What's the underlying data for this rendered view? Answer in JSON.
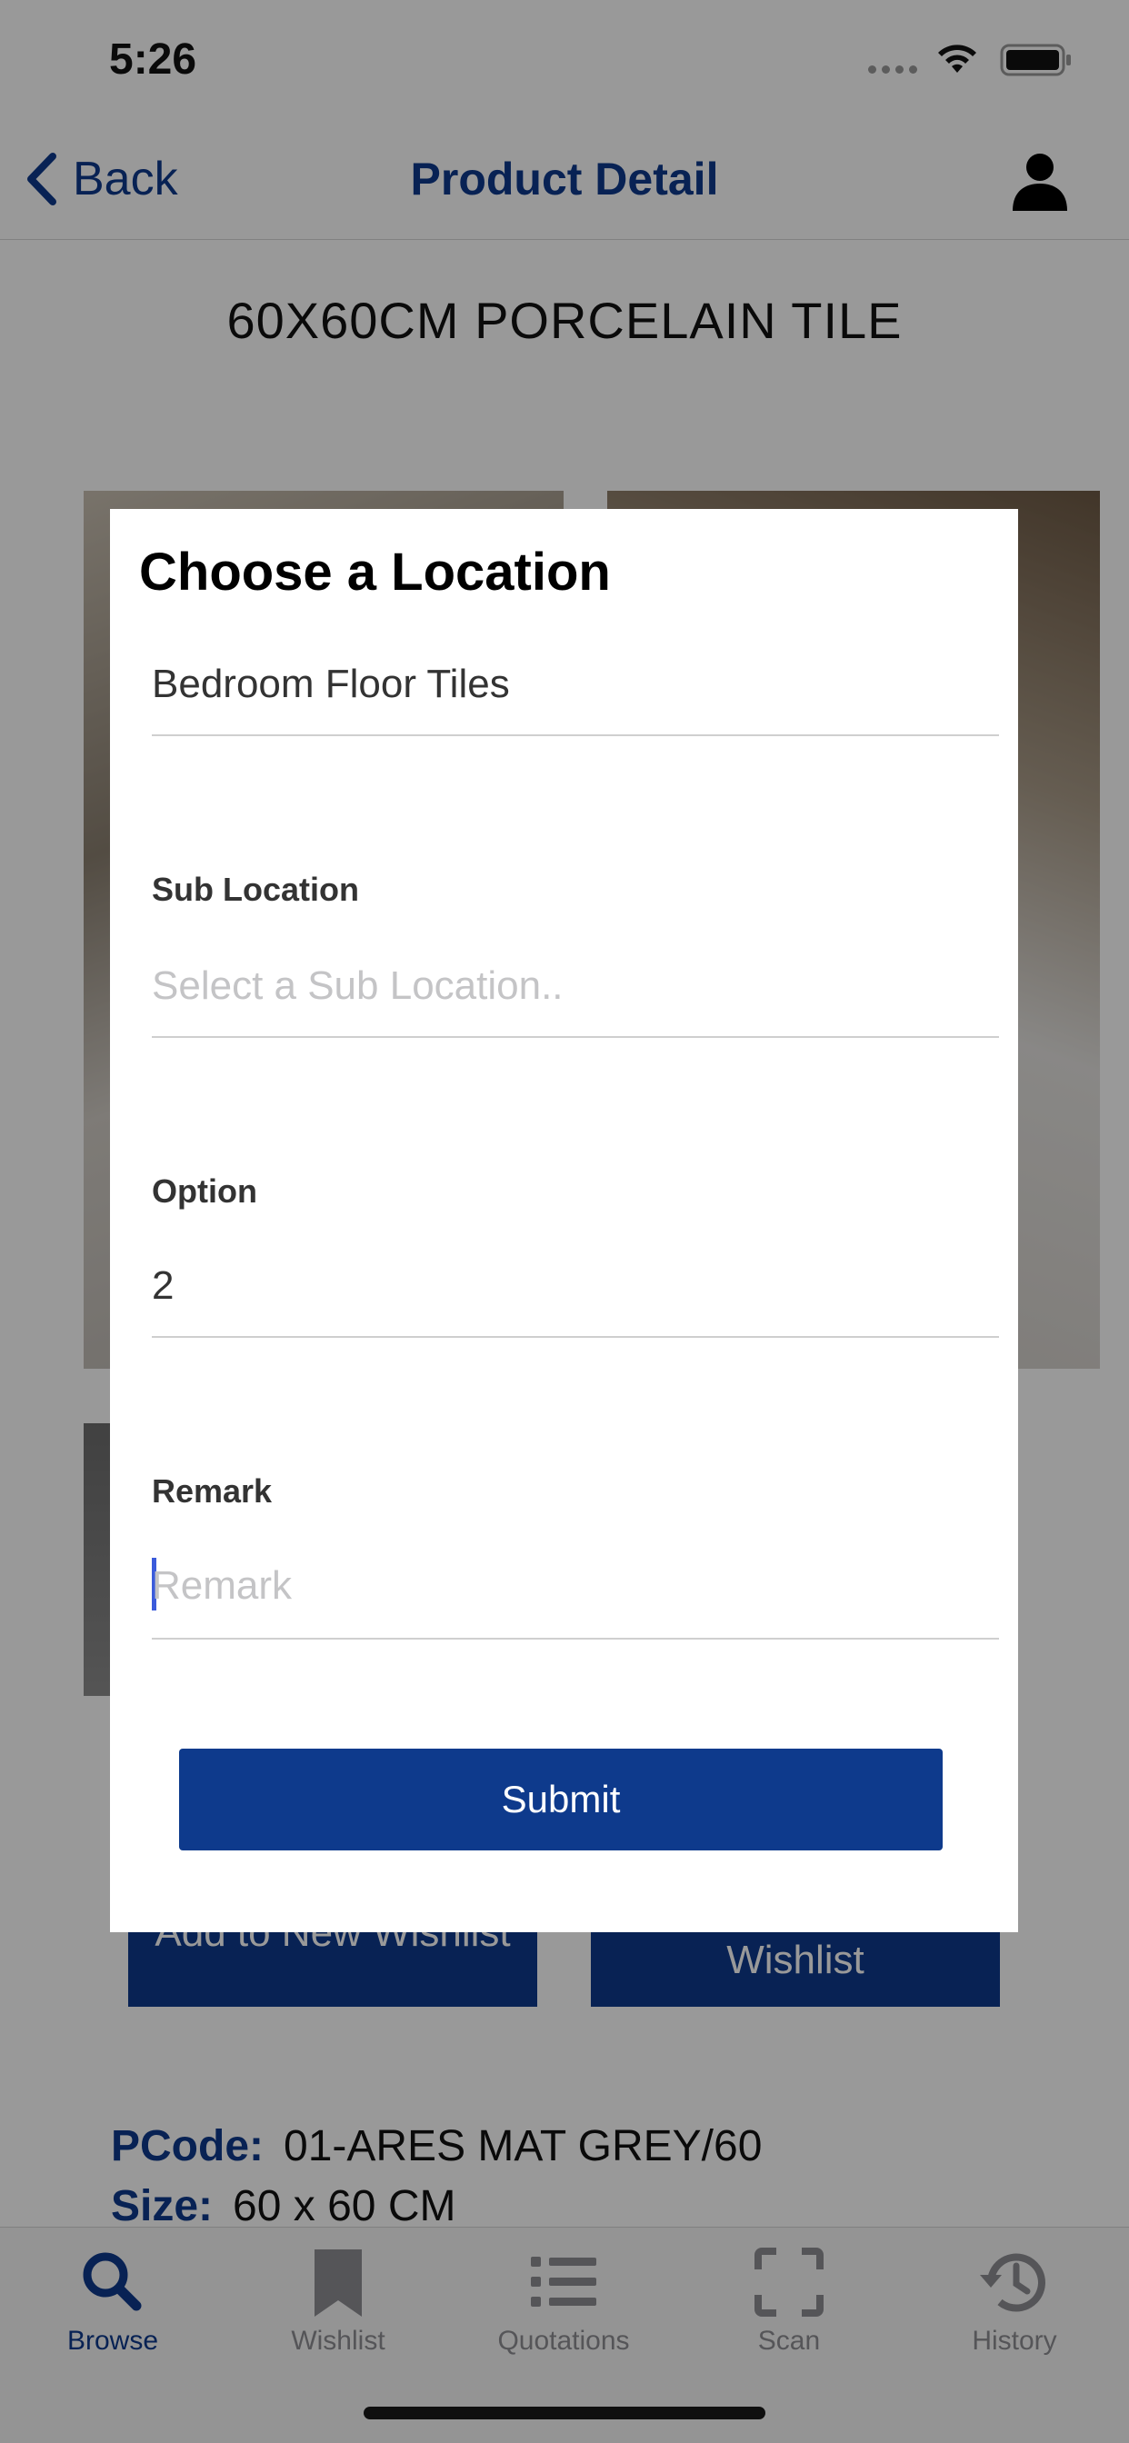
{
  "status_bar": {
    "time": "5:26"
  },
  "nav": {
    "back_label": "Back",
    "title": "Product Detail"
  },
  "product": {
    "title": "60X60CM PORCELAIN TILE",
    "add_new_wishlist_label": "Add to New Wishlist",
    "wishlist_label": "Wishlist",
    "pcode_label": "PCode:",
    "pcode_value": "01-ARES MAT GREY/60",
    "size_label": "Size:",
    "size_value": "60 x 60 CM"
  },
  "modal": {
    "title": "Choose a Location",
    "location_value": "Bedroom Floor Tiles",
    "sub_location_label": "Sub Location",
    "sub_location_placeholder": "Select a Sub Location..",
    "option_label": "Option",
    "option_value": "2",
    "remark_label": "Remark",
    "remark_placeholder": "Remark",
    "submit_label": "Submit"
  },
  "tabs": [
    {
      "label": "Browse",
      "icon": "search-icon",
      "active": true
    },
    {
      "label": "Wishlist",
      "icon": "bookmark-icon",
      "active": false
    },
    {
      "label": "Quotations",
      "icon": "list-icon",
      "active": false
    },
    {
      "label": "Scan",
      "icon": "scan-frame-icon",
      "active": false
    },
    {
      "label": "History",
      "icon": "history-clock-icon",
      "active": false
    }
  ],
  "colors": {
    "brand_blue": "#0e3a8c",
    "inactive_gray": "#8e8e93",
    "overlay": "rgba(0,0,0,0.4)",
    "caret": "#3b5bdb"
  }
}
